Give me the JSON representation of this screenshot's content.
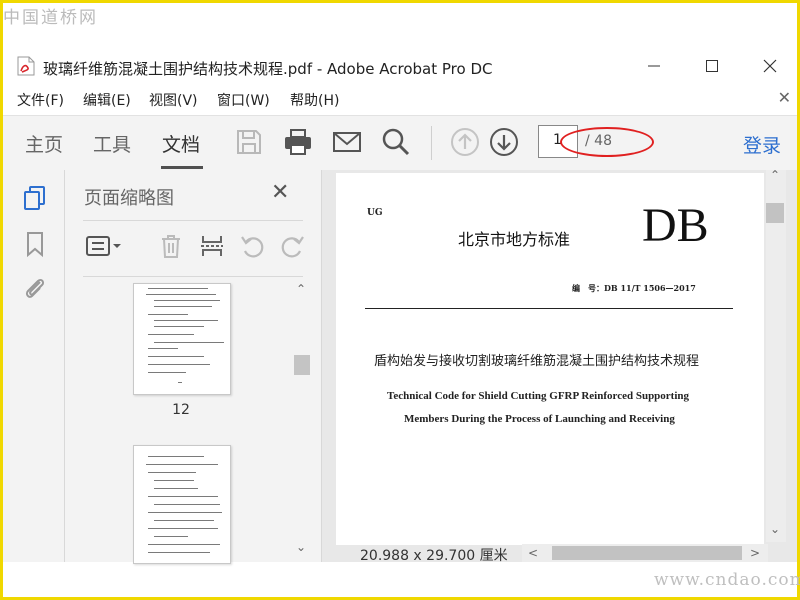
{
  "watermark": {
    "top": "中国道桥网",
    "bottom": "www.cndao.com"
  },
  "window": {
    "title": "玻璃纤维筋混凝土围护结构技术规程.pdf - Adobe Acrobat Pro DC"
  },
  "menu": {
    "items": [
      "文件(F)",
      "编辑(E)",
      "视图(V)",
      "窗口(W)",
      "帮助(H)"
    ]
  },
  "toolbar": {
    "tabs": [
      "主页",
      "工具",
      "文档"
    ],
    "active_tab": "文档",
    "page_current": "1",
    "page_total": "/ 48",
    "login_label": "登录"
  },
  "thumbnail_panel": {
    "title": "页面缩略图",
    "thumbnails": [
      {
        "label": "12"
      }
    ]
  },
  "document": {
    "header_ug": "UG",
    "header_org": "北京市地方标准",
    "header_db": "DB",
    "code_line": "编　号：DB 11/T 1506—2017",
    "title_cn": "盾构始发与接收切割玻璃纤维筋混凝土围护结构技术规程",
    "title_en_line1": "Technical Code for Shield Cutting GFRP Reinforced Supporting",
    "title_en_line2": "Members During the Process of Launching and Receiving",
    "page_size": "20.988 x 29.700 厘米"
  },
  "colors": {
    "accent": "#2d6fcf",
    "annotation": "#e02020",
    "watermark_border": "#f0d800"
  }
}
